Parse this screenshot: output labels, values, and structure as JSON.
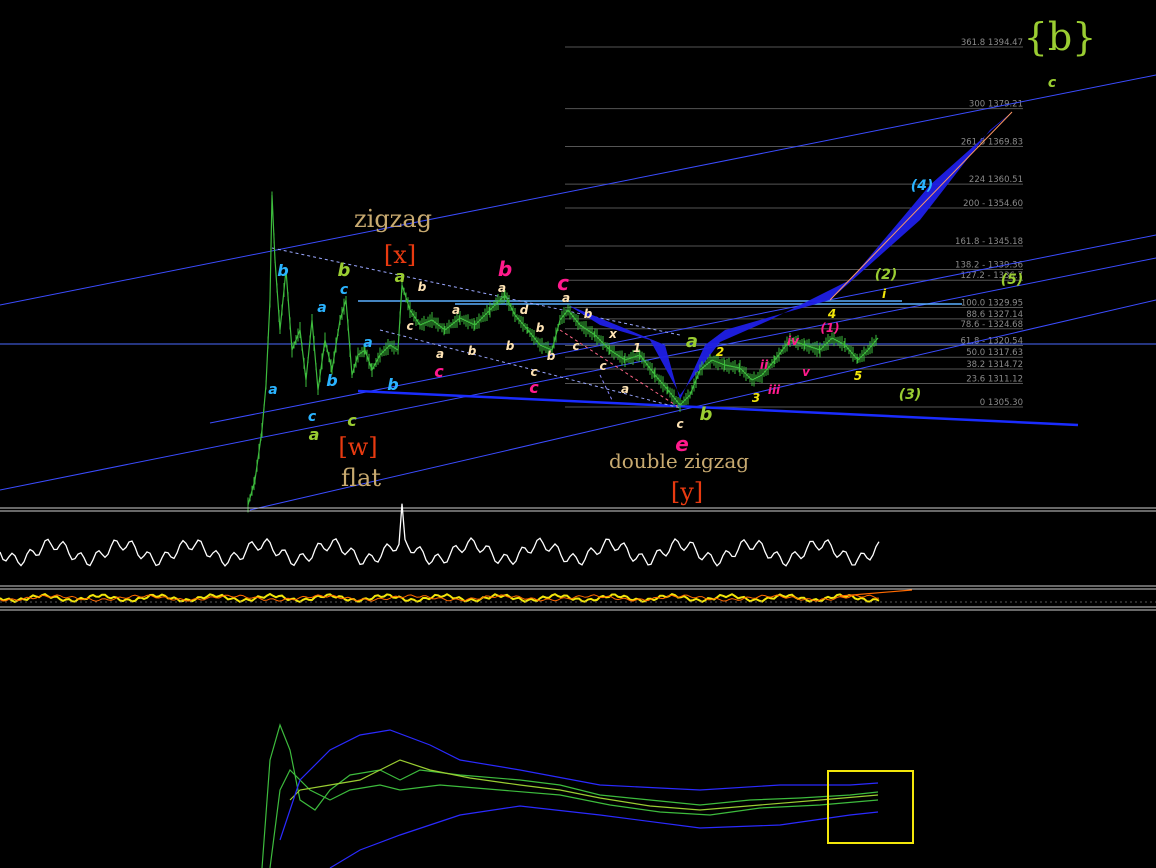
{
  "chart_data": {
    "type": "line",
    "price_panel": {
      "fib_levels": [
        {
          "label": "361.8  1394.47",
          "price": 1394.47
        },
        {
          "label": "300  1379.21",
          "price": 1379.21
        },
        {
          "label": "261.8  1369.83",
          "price": 1369.83
        },
        {
          "label": "224  1360.51",
          "price": 1360.51
        },
        {
          "label": "200 - 1354.60",
          "price": 1354.6
        },
        {
          "label": "161.8 - 1345.18",
          "price": 1345.18
        },
        {
          "label": "138.2 - 1339.36",
          "price": 1339.36
        },
        {
          "label": "127.2 - 1336.7",
          "price": 1336.7
        },
        {
          "label": "100.0  1329.95",
          "price": 1329.95
        },
        {
          "label": "88.6  1327.14",
          "price": 1327.14
        },
        {
          "label": "78.6 - 1324.68",
          "price": 1324.68
        },
        {
          "label": "61.8 - 1320.54",
          "price": 1320.54
        },
        {
          "label": "50.0  1317.63",
          "price": 1317.63
        },
        {
          "label": "38.2  1314.72",
          "price": 1314.72
        },
        {
          "label": "23.6  1311.12",
          "price": 1311.12
        },
        {
          "label": "0  1305.30",
          "price": 1305.3
        }
      ],
      "pattern_labels": [
        "zigzag",
        "flat",
        "double zigzag"
      ],
      "bracket_labels": [
        "[x]",
        "[w]",
        "[y]"
      ],
      "big_label": "{b}",
      "wave_labels": [
        "b",
        "a",
        "b",
        "a",
        "b",
        "c",
        "a",
        "c",
        "c",
        "b",
        "a",
        "b",
        "c",
        "a",
        "b",
        "c",
        "b",
        "a",
        "b",
        "a",
        "c",
        "a",
        "b",
        "d",
        "c",
        "b",
        "a",
        "c",
        "b",
        "c",
        "x",
        "c",
        "a",
        "e",
        "c",
        "a",
        "b",
        "1",
        "2",
        "3",
        "4",
        "5",
        "i",
        "ii",
        "iii",
        "iv",
        "v",
        "(1)",
        "(2)",
        "(3)",
        "(4)",
        "(5)",
        "c"
      ]
    },
    "indicator_panels": [
      "oscillator (white)",
      "oscillator (yellow/orange)",
      "bands (green/blue)"
    ]
  },
  "colors": {
    "background": "#000000",
    "price": "#3dbb3d",
    "fib_line": "#555555",
    "fib_text": "#8a8a8a",
    "channel": "#3b4cff",
    "target_zone": "#1f1fe6",
    "pattern_text": "#c8aa70",
    "bracket": "#e83a10",
    "big_label": "#9acd32",
    "cyan": "#2ab3ff",
    "green_label": "#9acd32",
    "magenta": "#ff1a8c",
    "yellow": "#f2e60a",
    "white_label": "#ffe4b5"
  }
}
